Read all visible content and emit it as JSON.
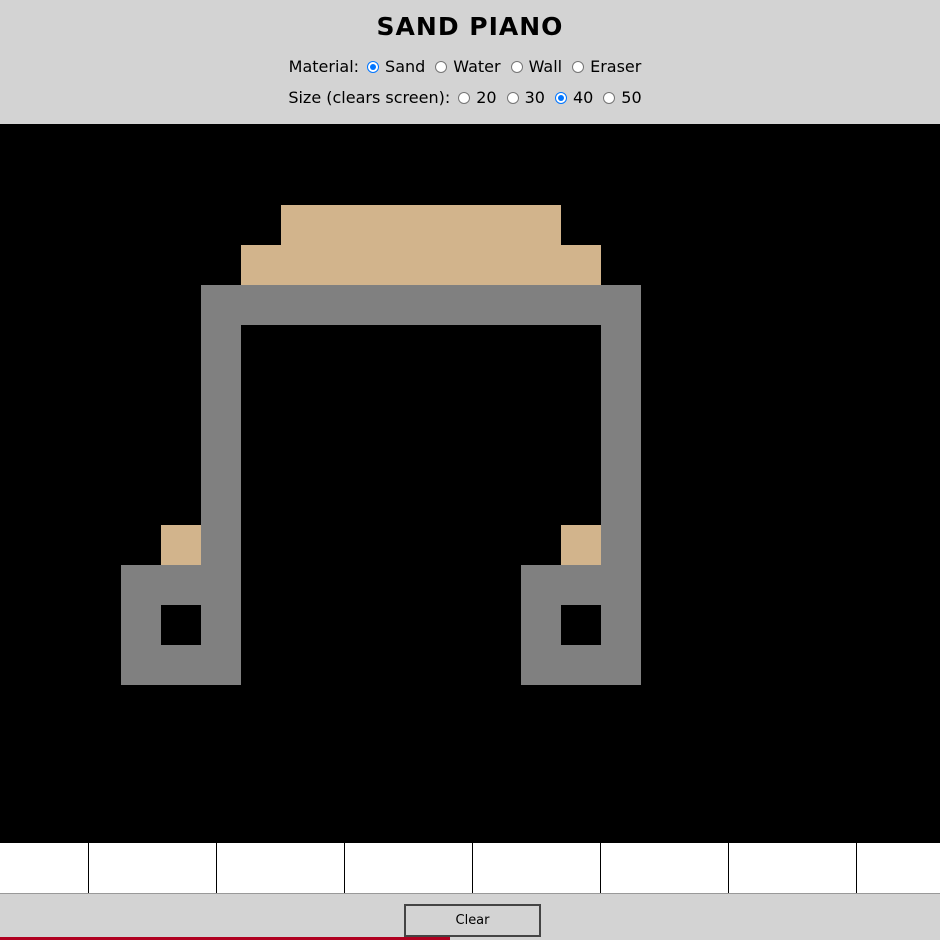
{
  "header": {
    "title": "SAND PIANO",
    "material_label": "Material:",
    "materials": [
      {
        "label": "Sand",
        "checked": true
      },
      {
        "label": "Water",
        "checked": false
      },
      {
        "label": "Wall",
        "checked": false
      },
      {
        "label": "Eraser",
        "checked": false
      }
    ],
    "size_label": "Size (clears screen):",
    "sizes": [
      {
        "label": "20",
        "checked": false
      },
      {
        "label": "30",
        "checked": false
      },
      {
        "label": "40",
        "checked": true
      },
      {
        "label": "50",
        "checked": false
      }
    ]
  },
  "colors": {
    "sand": "#d2b48c",
    "wall": "#808080",
    "background": "#000000",
    "panel": "#d3d3d3",
    "accent": "#0075ff"
  },
  "footer": {
    "clear_label": "Clear"
  }
}
